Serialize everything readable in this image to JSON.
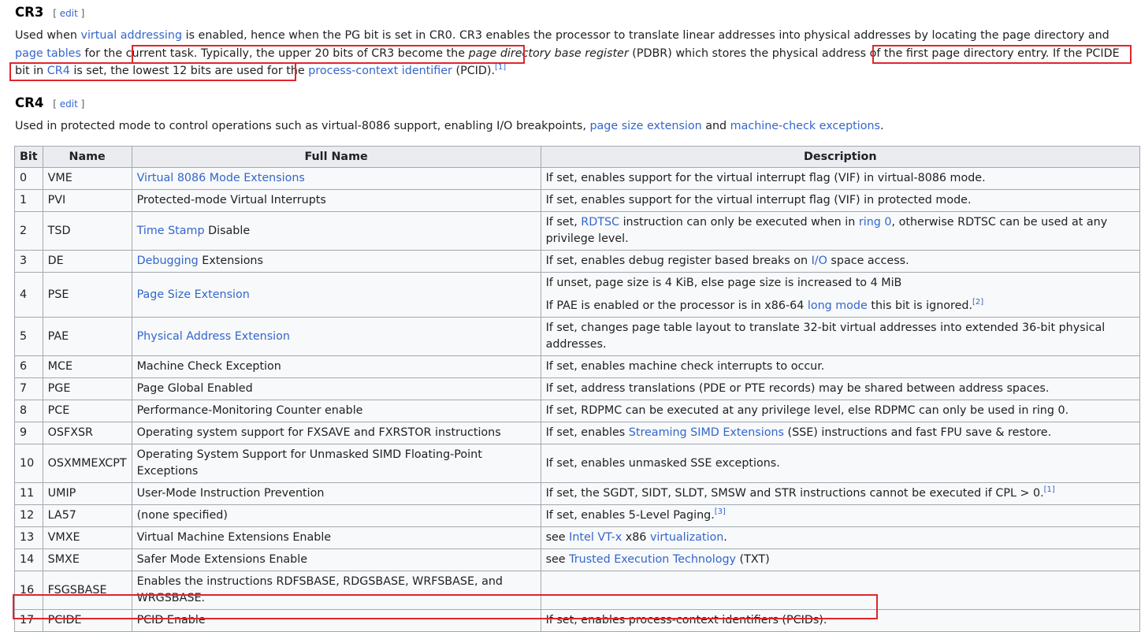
{
  "cr3": {
    "heading": "CR3",
    "edit": "edit",
    "p1": "Used when ",
    "l1": "virtual addressing",
    "p2": " is enabled, hence when the PG bit is set in CR0. CR3 enables the processor to translate linear addresses into physical addresses by locating the page directory and ",
    "l2": "page tables",
    "p3": " for the current task. Typically, ",
    "p4": "the upper 20 bits of CR3 become the ",
    "p5": "page directory base register",
    "p6": " (PDBR)",
    "p7": " which stores the physical address of the first page directory entry.",
    "p8": " If the PCIDE bit in ",
    "l3": "CR4",
    "p9": " is set, the lowest 12 bits are used for the ",
    "l4": "process-context identifier",
    "p10": " (PCID).",
    "ref": "[1]"
  },
  "cr4": {
    "heading": "CR4",
    "edit": "edit",
    "p1": "Used in protected mode to control operations such as virtual-8086 support, enabling I/O breakpoints, ",
    "l1": "page size extension",
    "p2": " and ",
    "l2": "machine-check exceptions",
    "p3": "."
  },
  "table": {
    "headers": [
      "Bit",
      "Name",
      "Full Name",
      "Description"
    ],
    "rows": [
      {
        "bit": "0",
        "name": "VME",
        "full": [
          {
            "t": "Virtual 8086 Mode Extensions",
            "link": true
          }
        ],
        "desc": [
          [
            {
              "t": "If set, enables support for the virtual interrupt flag (VIF) in virtual-8086 mode."
            }
          ]
        ]
      },
      {
        "bit": "1",
        "name": "PVI",
        "full": [
          {
            "t": "Protected-mode Virtual Interrupts"
          }
        ],
        "desc": [
          [
            {
              "t": "If set, enables support for the virtual interrupt flag (VIF) in protected mode."
            }
          ]
        ]
      },
      {
        "bit": "2",
        "name": "TSD",
        "full": [
          {
            "t": "Time Stamp",
            "link": true
          },
          {
            "t": " Disable"
          }
        ],
        "desc": [
          [
            {
              "t": "If set, "
            },
            {
              "t": "RDTSC",
              "link": true
            },
            {
              "t": " instruction can only be executed when in "
            },
            {
              "t": "ring 0",
              "link": true
            },
            {
              "t": ", otherwise RDTSC can be used at any privilege level."
            }
          ]
        ]
      },
      {
        "bit": "3",
        "name": "DE",
        "full": [
          {
            "t": "Debugging",
            "link": true
          },
          {
            "t": " Extensions"
          }
        ],
        "desc": [
          [
            {
              "t": "If set, enables debug register based breaks on "
            },
            {
              "t": "I/O",
              "link": true
            },
            {
              "t": " space access."
            }
          ]
        ]
      },
      {
        "bit": "4",
        "name": "PSE",
        "full": [
          {
            "t": "Page Size Extension",
            "link": true
          }
        ],
        "desc": [
          [
            {
              "t": "If unset, page size is 4 KiB, else page size is increased to 4 MiB"
            }
          ],
          [
            {
              "t": "If PAE is enabled or the processor is in x86-64 "
            },
            {
              "t": "long mode",
              "link": true
            },
            {
              "t": " this bit is ignored."
            },
            {
              "t": "[2]",
              "sup": true
            }
          ]
        ]
      },
      {
        "bit": "5",
        "name": "PAE",
        "full": [
          {
            "t": "Physical Address Extension",
            "link": true
          }
        ],
        "desc": [
          [
            {
              "t": "If set, changes page table layout to translate 32-bit virtual addresses into extended 36-bit physical addresses."
            }
          ]
        ]
      },
      {
        "bit": "6",
        "name": "MCE",
        "full": [
          {
            "t": "Machine Check Exception"
          }
        ],
        "desc": [
          [
            {
              "t": "If set, enables machine check interrupts to occur."
            }
          ]
        ]
      },
      {
        "bit": "7",
        "name": "PGE",
        "full": [
          {
            "t": "Page Global Enabled"
          }
        ],
        "desc": [
          [
            {
              "t": "If set, address translations (PDE or PTE records) may be shared between address spaces."
            }
          ]
        ]
      },
      {
        "bit": "8",
        "name": "PCE",
        "full": [
          {
            "t": "Performance-Monitoring Counter enable"
          }
        ],
        "desc": [
          [
            {
              "t": "If set, RDPMC can be executed at any privilege level, else RDPMC can only be used in ring 0."
            }
          ]
        ]
      },
      {
        "bit": "9",
        "name": "OSFXSR",
        "full": [
          {
            "t": "Operating system support for FXSAVE and FXRSTOR instructions"
          }
        ],
        "desc": [
          [
            {
              "t": "If set, enables "
            },
            {
              "t": "Streaming SIMD Extensions",
              "link": true
            },
            {
              "t": " (SSE) instructions and fast FPU save & restore."
            }
          ]
        ]
      },
      {
        "bit": "10",
        "name": "OSXMMEXCPT",
        "full": [
          {
            "t": "Operating System Support for Unmasked SIMD Floating-Point Exceptions"
          }
        ],
        "desc": [
          [
            {
              "t": "If set, enables unmasked SSE exceptions."
            }
          ]
        ]
      },
      {
        "bit": "11",
        "name": "UMIP",
        "full": [
          {
            "t": "User-Mode Instruction Prevention"
          }
        ],
        "desc": [
          [
            {
              "t": "If set, the SGDT, SIDT, SLDT, SMSW and STR instructions cannot be executed if CPL > 0."
            },
            {
              "t": "[1]",
              "sup": true
            }
          ]
        ]
      },
      {
        "bit": "12",
        "name": "LA57",
        "full": [
          {
            "t": "(none specified)"
          }
        ],
        "desc": [
          [
            {
              "t": "If set, enables 5-Level Paging."
            },
            {
              "t": "[3]",
              "sup": true
            }
          ]
        ]
      },
      {
        "bit": "13",
        "name": "VMXE",
        "full": [
          {
            "t": "Virtual Machine Extensions Enable"
          }
        ],
        "desc": [
          [
            {
              "t": "see "
            },
            {
              "t": "Intel VT-x",
              "link": true
            },
            {
              "t": " x86 "
            },
            {
              "t": "virtualization",
              "link": true
            },
            {
              "t": "."
            }
          ]
        ]
      },
      {
        "bit": "14",
        "name": "SMXE",
        "full": [
          {
            "t": "Safer Mode Extensions Enable"
          }
        ],
        "desc": [
          [
            {
              "t": "see "
            },
            {
              "t": "Trusted Execution Technology",
              "link": true
            },
            {
              "t": " (TXT)"
            }
          ]
        ]
      },
      {
        "bit": "16",
        "name": "FSGSBASE",
        "full": [
          {
            "t": "Enables the instructions RDFSBASE, RDGSBASE, WRFSBASE, and WRGSBASE."
          }
        ],
        "desc": []
      },
      {
        "bit": "17",
        "name": "PCIDE",
        "full": [
          {
            "t": "PCID Enable"
          }
        ],
        "desc": [
          [
            {
              "t": "If set, enables process-context identifiers (PCIDs)."
            }
          ]
        ]
      }
    ]
  }
}
